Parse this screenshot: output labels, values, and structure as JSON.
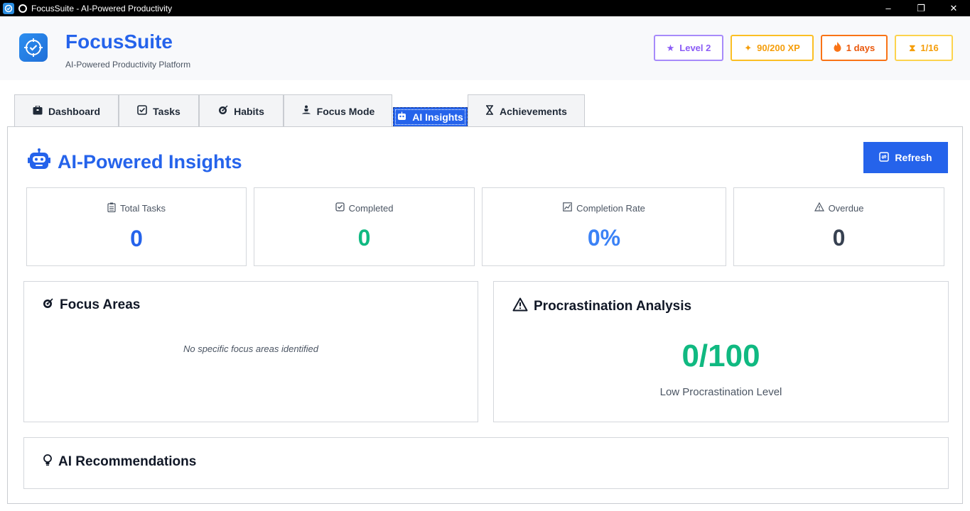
{
  "window": {
    "title": "FocusSuite - AI-Powered Productivity",
    "controls": [
      "–",
      "❐",
      "✕"
    ]
  },
  "header": {
    "brand": "FocusSuite",
    "tagline": "AI-Powered Productivity Platform",
    "badges": {
      "level": "Level 2",
      "xp": "90/200 XP",
      "streak": "1 days",
      "achievements": "1/16"
    }
  },
  "tabs": [
    {
      "label": "Dashboard",
      "icon": "briefcase-icon"
    },
    {
      "label": "Tasks",
      "icon": "checkbox-icon"
    },
    {
      "label": "Habits",
      "icon": "target-icon"
    },
    {
      "label": "Focus Mode",
      "icon": "meditation-icon"
    },
    {
      "label": "AI Insights",
      "icon": "robot-icon",
      "active": true
    },
    {
      "label": "Achievements",
      "icon": "hourglass-icon"
    }
  ],
  "insights": {
    "title": "AI-Powered Insights",
    "refresh_label": "Refresh",
    "stats": {
      "total_tasks": {
        "label": "Total Tasks",
        "value": "0"
      },
      "completed": {
        "label": "Completed",
        "value": "0"
      },
      "completion_rate": {
        "label": "Completion Rate",
        "value": "0%"
      },
      "overdue": {
        "label": "Overdue",
        "value": "0"
      }
    },
    "focus_areas": {
      "title": "Focus Areas",
      "empty": "No specific focus areas identified"
    },
    "procrastination": {
      "title": "Procrastination Analysis",
      "score": "0/100",
      "level": "Low Procrastination Level"
    },
    "recommendations": {
      "title": "AI Recommendations"
    }
  },
  "colors": {
    "accent": "#2563eb",
    "success": "#10b981",
    "overdue": "#374151"
  }
}
